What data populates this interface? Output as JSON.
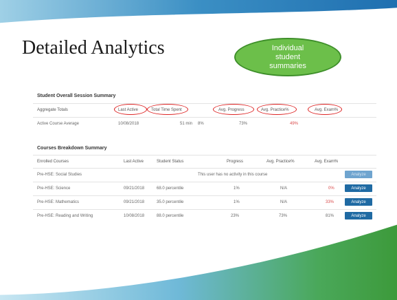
{
  "slide": {
    "title": "Detailed Analytics",
    "callout": "Individual\nstudent\nsummaries"
  },
  "session_summary": {
    "title": "Student Overall Session Summary",
    "headers": [
      "Aggregate Totals",
      "Last Active",
      "Total Time Spent",
      "Avg. Progress",
      "Avg. Practice%",
      "Avg. Exam%"
    ],
    "row": {
      "label": "Active Course Average",
      "last_active": "10/08/2018",
      "time_spent": "51 min",
      "progress_a": "8%",
      "progress_b": "73%",
      "practice": "49%"
    }
  },
  "courses_summary": {
    "title": "Courses Breakdown Summary",
    "headers": [
      "Enrolled Courses",
      "Last Active",
      "Student Status",
      "Progress",
      "Avg. Practice%",
      "Avg. Exam%"
    ],
    "rows": [
      {
        "course": "Pre-HSE: Social Studies",
        "message": "This user has no activity in this course",
        "button": "Analyze"
      },
      {
        "course": "Pre-HSE: Science",
        "last_active": "09/21/2018",
        "status": "68.0 percentile",
        "progress": "1%",
        "practice": "N/A",
        "exam": "0%",
        "button": "Analyze"
      },
      {
        "course": "Pre-HSE: Mathematics",
        "last_active": "09/21/2018",
        "status": "35.0 percentile",
        "progress": "1%",
        "practice": "N/A",
        "exam": "33%",
        "button": "Analyze"
      },
      {
        "course": "Pre-HSE: Reading and Writing",
        "last_active": "10/08/2018",
        "status": "88.0 percentile",
        "progress": "23%",
        "practice": "73%",
        "exam": "81%",
        "button": "Analyze"
      }
    ]
  }
}
